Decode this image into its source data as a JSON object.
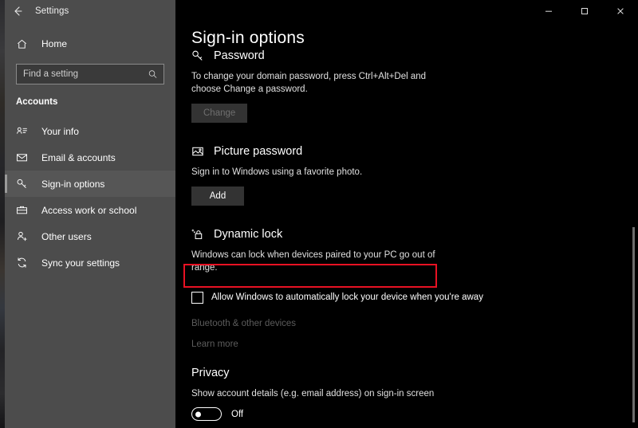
{
  "window": {
    "app_title": "Settings",
    "back_icon": "back-arrow-icon",
    "minimize_label": "Minimize",
    "maximize_label": "Maximize",
    "close_label": "Close"
  },
  "sidebar": {
    "home": {
      "label": "Home",
      "icon": "home-icon"
    },
    "search": {
      "placeholder": "Find a setting",
      "value": "",
      "icon": "search-icon"
    },
    "section_label": "Accounts",
    "items": [
      {
        "label": "Your info",
        "icon": "account-info-icon",
        "selected": false
      },
      {
        "label": "Email & accounts",
        "icon": "envelope-icon",
        "selected": false
      },
      {
        "label": "Sign-in options",
        "icon": "key-icon",
        "selected": true
      },
      {
        "label": "Access work or school",
        "icon": "briefcase-icon",
        "selected": false
      },
      {
        "label": "Other users",
        "icon": "person-add-icon",
        "selected": false
      },
      {
        "label": "Sync your settings",
        "icon": "sync-icon",
        "selected": false
      }
    ]
  },
  "main": {
    "page_title": "Sign-in options",
    "password": {
      "title": "Password",
      "icon": "key-icon",
      "description": "To change your domain password, press Ctrl+Alt+Del and choose Change a password.",
      "button_label": "Change",
      "button_disabled": true
    },
    "picture_password": {
      "title": "Picture password",
      "icon": "picture-icon",
      "description": "Sign in to Windows using a favorite photo.",
      "button_label": "Add",
      "button_disabled": false
    },
    "dynamic_lock": {
      "title": "Dynamic lock",
      "icon": "lock-sparkle-icon",
      "description": "Windows can lock when devices paired to your PC go out of range.",
      "checkbox_label": "Allow Windows to automatically lock your device when you're away",
      "checkbox_checked": false,
      "highlight_color": "#e81123",
      "links": [
        "Bluetooth & other devices",
        "Learn more"
      ]
    },
    "privacy": {
      "title": "Privacy",
      "description": "Show account details (e.g. email address) on sign-in screen",
      "toggle_state": "Off",
      "toggle_on": false
    }
  }
}
